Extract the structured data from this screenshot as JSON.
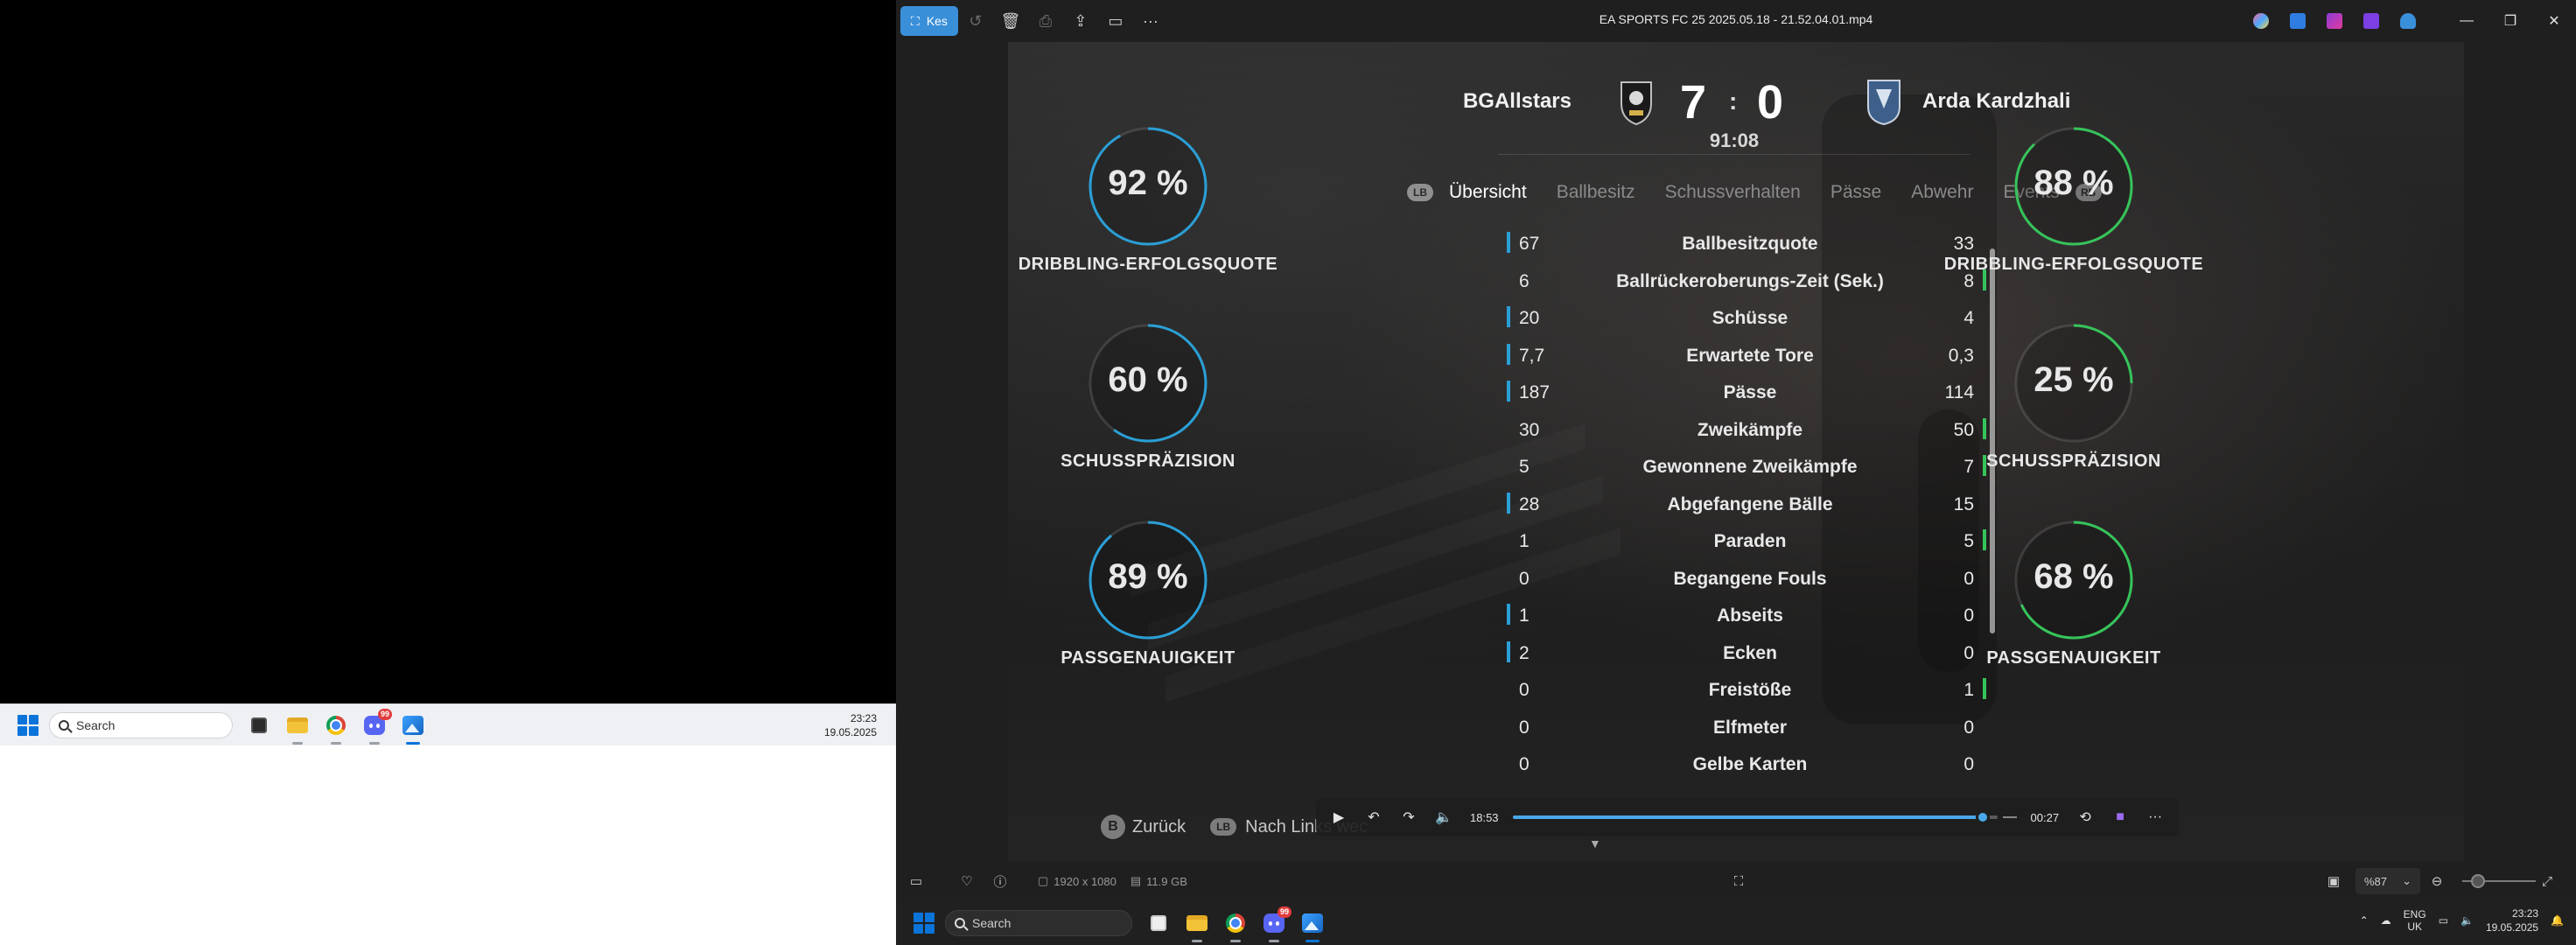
{
  "left_taskbar": {
    "search_placeholder": "Search",
    "time": "23:23",
    "date": "19.05.2025"
  },
  "viewer": {
    "kes_label": "Kes",
    "file_title": "EA SPORTS FC 25 2025.05.18 - 21.52.04.01.mp4",
    "status": {
      "resolution": "1920 x 1080",
      "file_size": "11.9 GB",
      "zoom": "%87"
    },
    "player": {
      "elapsed": "18:53",
      "remaining": "00:27",
      "progress": 0.97
    }
  },
  "match": {
    "home_team": "BGAllstars",
    "away_team": "Arda Kardzhali",
    "home_score": "7",
    "away_score": "0",
    "score_sep": ":",
    "clock": "91:08",
    "lb": "LB",
    "rb": "RB",
    "tabs": [
      "Übersicht",
      "Ballbesitz",
      "Schussverhalten",
      "Pässe",
      "Abwehr",
      "Events"
    ],
    "active_tab": 0,
    "home_rings": [
      {
        "value": "92 %",
        "label": "DRIBBLING-ERFOLGSQUOTE",
        "fraction": 0.92
      },
      {
        "value": "60 %",
        "label": "SCHUSSPRÄZISION",
        "fraction": 0.6
      },
      {
        "value": "89 %",
        "label": "PASSGENAUIGKEIT",
        "fraction": 0.89
      }
    ],
    "away_rings": [
      {
        "value": "88 %",
        "label": "DRIBBLING-ERFOLGSQUOTE",
        "fraction": 0.88
      },
      {
        "value": "25 %",
        "label": "SCHUSSPRÄZISION",
        "fraction": 0.25
      },
      {
        "value": "68 %",
        "label": "PASSGENAUIGKEIT",
        "fraction": 0.68
      }
    ],
    "stats": [
      {
        "home": "67",
        "name": "Ballbesitzquote",
        "away": "33",
        "lead": "home"
      },
      {
        "home": "6",
        "name": "Ballrückeroberungs-Zeit (Sek.)",
        "away": "8",
        "lead": "away"
      },
      {
        "home": "20",
        "name": "Schüsse",
        "away": "4",
        "lead": "home"
      },
      {
        "home": "7,7",
        "name": "Erwartete Tore",
        "away": "0,3",
        "lead": "home"
      },
      {
        "home": "187",
        "name": "Pässe",
        "away": "114",
        "lead": "home"
      },
      {
        "home": "30",
        "name": "Zweikämpfe",
        "away": "50",
        "lead": "away"
      },
      {
        "home": "5",
        "name": "Gewonnene Zweikämpfe",
        "away": "7",
        "lead": "away"
      },
      {
        "home": "28",
        "name": "Abgefangene Bälle",
        "away": "15",
        "lead": "home"
      },
      {
        "home": "1",
        "name": "Paraden",
        "away": "5",
        "lead": "away"
      },
      {
        "home": "0",
        "name": "Begangene Fouls",
        "away": "0",
        "lead": "none"
      },
      {
        "home": "1",
        "name": "Abseits",
        "away": "0",
        "lead": "home"
      },
      {
        "home": "2",
        "name": "Ecken",
        "away": "0",
        "lead": "home"
      },
      {
        "home": "0",
        "name": "Freistöße",
        "away": "1",
        "lead": "away"
      },
      {
        "home": "0",
        "name": "Elfmeter",
        "away": "0",
        "lead": "none"
      },
      {
        "home": "0",
        "name": "Gelbe Karten",
        "away": "0",
        "lead": "none"
      }
    ],
    "hints": {
      "back_button": "B",
      "back": "Zurück",
      "lb_button": "LB",
      "nav_left": "Nach Links wec"
    },
    "colors": {
      "home": "#2a9fd6",
      "away": "#36c45a"
    }
  },
  "right_taskbar": {
    "search_placeholder": "Search",
    "lang_top": "ENG",
    "lang_bottom": "UK",
    "time": "23:23",
    "date": "19.05.2025",
    "discord_badge": "99"
  }
}
